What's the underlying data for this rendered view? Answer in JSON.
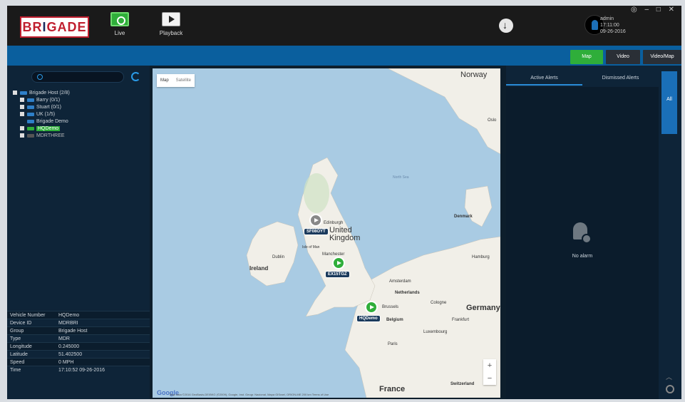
{
  "header": {
    "logo": "BRIGADE",
    "nav": [
      {
        "label": "Live",
        "icon": "live-monitor-icon"
      },
      {
        "label": "Playback",
        "icon": "playback-icon"
      }
    ],
    "user": {
      "name": "admin",
      "time": "17:11:00",
      "date": "09-26-2016"
    },
    "window_controls": "◎ – □ ✕"
  },
  "view_tabs": [
    {
      "label": "Map",
      "active": true,
      "color": "#2fae3a"
    },
    {
      "label": "Video"
    },
    {
      "label": "Video/Map"
    }
  ],
  "tree": [
    {
      "label": "Brigade Host (2/8)",
      "level": 0
    },
    {
      "label": "Barry (0/1)",
      "level": 1
    },
    {
      "label": "Stuart (0/1)",
      "level": 1
    },
    {
      "label": "UK (1/5)",
      "level": 1
    },
    {
      "label": "Brigade Demo",
      "level": 1
    },
    {
      "label": "HQDemo",
      "level": 1,
      "selected": true
    },
    {
      "label": "MDRTHREE",
      "level": 1
    }
  ],
  "vehicle_info": [
    {
      "key": "Vehicle Number",
      "value": "HQDemo"
    },
    {
      "key": "Device ID",
      "value": "MDRBRI"
    },
    {
      "key": "Group",
      "value": "Brigade Host"
    },
    {
      "key": "Type",
      "value": "MDR"
    },
    {
      "key": "Longitude",
      "value": "0.245000"
    },
    {
      "key": "Latitude",
      "value": "51.402500"
    },
    {
      "key": "Speed",
      "value": "0 MPH"
    },
    {
      "key": "Time",
      "value": "17:10:52 09-26-2016"
    }
  ],
  "map": {
    "type_toggle": [
      "Map",
      "Satellite"
    ],
    "labels": {
      "norway": "Norway",
      "oslo": "Oslo",
      "edinburgh": "Edinburgh",
      "united_kingdom": "United Kingdom",
      "isle_of_man": "Isle of Man",
      "ireland": "Ireland",
      "dublin": "Dublin",
      "manchester": "Manchester",
      "denmark": "Denmark",
      "hamburg": "Hamburg",
      "amsterdam": "Amsterdam",
      "netherlands": "Netherlands",
      "brussels": "Brussels",
      "cologne": "Cologne",
      "belgium": "Belgium",
      "germany": "Germany",
      "frankfurt": "Frankfurt",
      "luxembourg": "Luxembourg",
      "paris": "Paris",
      "france": "France",
      "switzerland": "Switzerland",
      "north_sea": "North Sea"
    },
    "vehicles": [
      {
        "tag": "SF08OYT",
        "status": "idle"
      },
      {
        "tag": "EX15TGZ",
        "status": "moving"
      },
      {
        "tag": "HQDemo",
        "status": "moving"
      }
    ],
    "zoom_in": "+",
    "zoom_out": "−",
    "credit": "Map data ©2016 GeoBasis-DE/BKG (©2009), Google, Inst. Geogr. Nacional, Mapa GISrael, ORION-ME   200 km   Terms of Use",
    "google": "Google"
  },
  "alerts": {
    "tabs": [
      "Active Alerts",
      "Dismissed Alerts"
    ],
    "empty_text": "No alarm",
    "side_tab": "All"
  },
  "colors": {
    "accent": "#2fae3a",
    "strip": "#0a5f9e",
    "panel": "#0e2438"
  }
}
